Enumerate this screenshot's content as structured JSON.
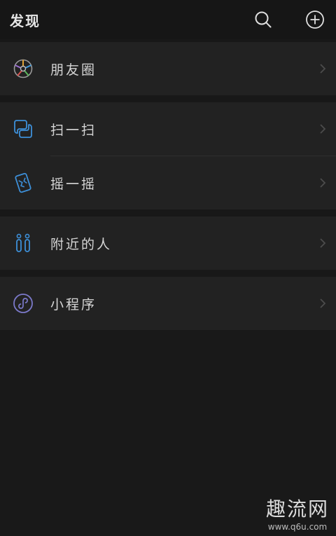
{
  "header": {
    "title": "发现",
    "search_icon": "search-icon",
    "add_icon": "plus-circle-icon"
  },
  "items": [
    {
      "label": "朋友圈",
      "icon": "moments-icon"
    },
    {
      "label": "扫一扫",
      "icon": "scan-icon"
    },
    {
      "label": "摇一摇",
      "icon": "shake-icon"
    },
    {
      "label": "附近的人",
      "icon": "people-nearby-icon"
    },
    {
      "label": "小程序",
      "icon": "mini-program-icon"
    }
  ],
  "watermark": {
    "main": "趣流网",
    "url": "www.q6u.com"
  },
  "colors": {
    "background": "#191919",
    "row_background": "#222222",
    "accent_blue": "#3d8fd8",
    "mini_program_purple": "#7b79c9"
  }
}
